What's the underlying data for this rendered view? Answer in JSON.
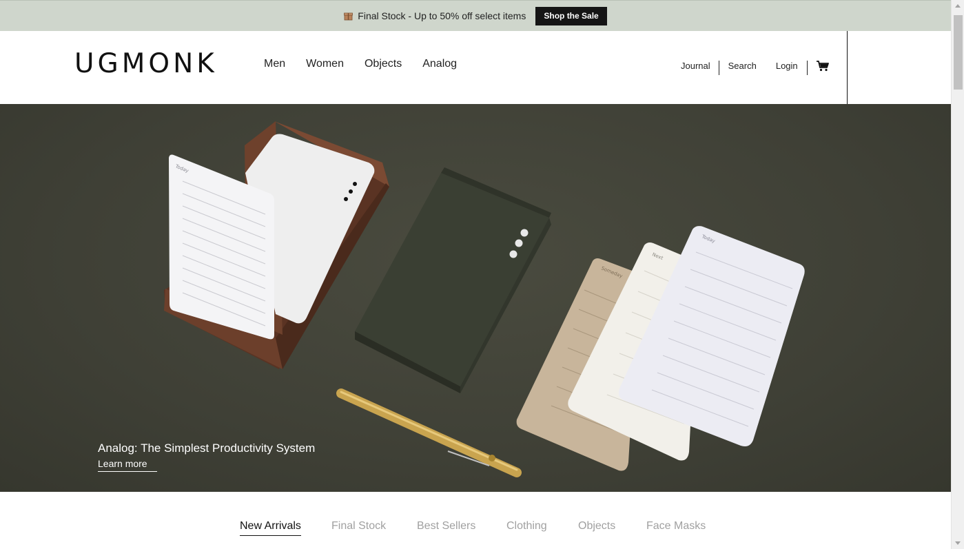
{
  "announcement": {
    "text": "Final Stock - Up to 50% off select items",
    "button_label": "Shop the Sale",
    "gift_icon": "gift-box-icon"
  },
  "header": {
    "logo": "UGMONK",
    "nav": [
      {
        "label": "Men"
      },
      {
        "label": "Women"
      },
      {
        "label": "Objects"
      },
      {
        "label": "Analog"
      }
    ],
    "utility": {
      "journal": "Journal",
      "search": "Search",
      "login": "Login",
      "cart_icon": "cart-icon"
    }
  },
  "hero": {
    "title": "Analog: The Simplest Productivity System",
    "link_label": "Learn more",
    "card_labels": {
      "today": "Today",
      "next": "Next",
      "someday": "Someday"
    }
  },
  "tabs": [
    {
      "label": "New Arrivals",
      "active": true
    },
    {
      "label": "Final Stock",
      "active": false
    },
    {
      "label": "Best Sellers",
      "active": false
    },
    {
      "label": "Clothing",
      "active": false
    },
    {
      "label": "Objects",
      "active": false
    },
    {
      "label": "Face Masks",
      "active": false
    }
  ],
  "colors": {
    "announce_bg": "#cfd6cc",
    "hero_bg": "#3f4036",
    "tab_inactive": "#a0a0a0"
  }
}
